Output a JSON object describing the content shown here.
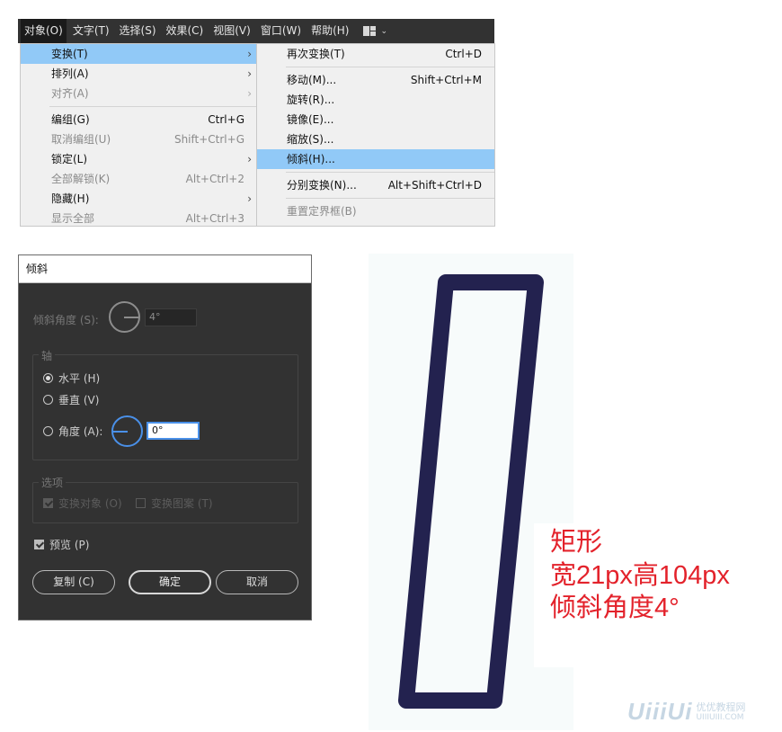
{
  "menubar": {
    "items": [
      "对象(O)",
      "文字(T)",
      "选择(S)",
      "效果(C)",
      "视图(V)",
      "窗口(W)",
      "帮助(H)"
    ]
  },
  "object_menu": {
    "items": [
      {
        "label": "变换(T)",
        "shortcut": "",
        "submenu": true,
        "disabled": false,
        "highlighted": true
      },
      {
        "label": "排列(A)",
        "shortcut": "",
        "submenu": true,
        "disabled": false,
        "highlighted": false
      },
      {
        "label": "对齐(A)",
        "shortcut": "",
        "submenu": true,
        "disabled": true,
        "highlighted": false
      },
      {
        "label": "编组(G)",
        "shortcut": "Ctrl+G",
        "submenu": false,
        "disabled": false,
        "highlighted": false
      },
      {
        "label": "取消编组(U)",
        "shortcut": "Shift+Ctrl+G",
        "submenu": false,
        "disabled": true,
        "highlighted": false
      },
      {
        "label": "锁定(L)",
        "shortcut": "",
        "submenu": true,
        "disabled": false,
        "highlighted": false
      },
      {
        "label": "全部解锁(K)",
        "shortcut": "Alt+Ctrl+2",
        "submenu": false,
        "disabled": true,
        "highlighted": false
      },
      {
        "label": "隐藏(H)",
        "shortcut": "",
        "submenu": true,
        "disabled": false,
        "highlighted": false
      },
      {
        "label": "显示全部",
        "shortcut": "Alt+Ctrl+3",
        "submenu": false,
        "disabled": true,
        "highlighted": false
      }
    ]
  },
  "transform_menu": {
    "items": [
      {
        "label": "再次变换(T)",
        "shortcut": "Ctrl+D",
        "disabled": false,
        "highlighted": false
      },
      {
        "label": "移动(M)...",
        "shortcut": "Shift+Ctrl+M",
        "disabled": false,
        "highlighted": false
      },
      {
        "label": "旋转(R)...",
        "shortcut": "",
        "disabled": false,
        "highlighted": false
      },
      {
        "label": "镜像(E)...",
        "shortcut": "",
        "disabled": false,
        "highlighted": false
      },
      {
        "label": "缩放(S)...",
        "shortcut": "",
        "disabled": false,
        "highlighted": false
      },
      {
        "label": "倾斜(H)...",
        "shortcut": "",
        "disabled": false,
        "highlighted": true
      },
      {
        "label": "分别变换(N)...",
        "shortcut": "Alt+Shift+Ctrl+D",
        "disabled": false,
        "highlighted": false
      },
      {
        "label": "重置定界框(B)",
        "shortcut": "",
        "disabled": true,
        "highlighted": false
      }
    ]
  },
  "shear_dialog": {
    "title": "倾斜",
    "shear_angle_label": "倾斜角度 (S):",
    "shear_angle_value": "4°",
    "axis_group_label": "轴",
    "horizontal_label": "水平 (H)",
    "vertical_label": "垂直 (V)",
    "angle_label": "角度 (A):",
    "angle_value": "0°",
    "axis_selected": "horizontal",
    "options_group_label": "选项",
    "transform_objects_label": "变换对象 (O)",
    "transform_patterns_label": "变换图案 (T)",
    "preview_label": "预览 (P)",
    "preview_checked": true,
    "copy_button": "复制 (C)",
    "ok_button": "确定",
    "cancel_button": "取消"
  },
  "illustration": {
    "shape_color": "#23224f",
    "annotation_color": "#e3222b",
    "annotation_lines": [
      "矩形",
      "宽21px高104px",
      "倾斜角度4°"
    ]
  },
  "watermark": {
    "logo_text": "UiiiUi",
    "site_name": "优优教程网",
    "site_url": "UIIIUIII.COM"
  }
}
